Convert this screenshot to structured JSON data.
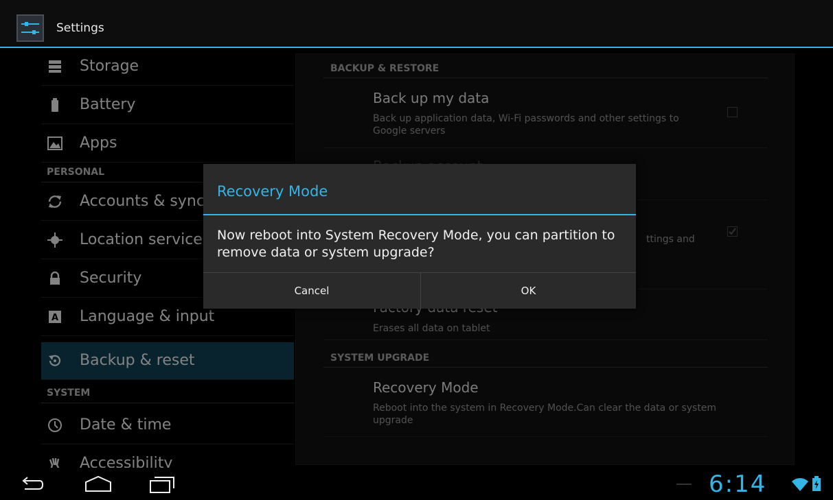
{
  "action_bar": {
    "title": "Settings"
  },
  "sidebar": {
    "items": [
      {
        "label": "Storage",
        "icon": "storage-icon"
      },
      {
        "label": "Battery",
        "icon": "battery-icon"
      },
      {
        "label": "Apps",
        "icon": "apps-icon"
      },
      {
        "label": "Accounts & sync",
        "icon": "sync-icon"
      },
      {
        "label": "Location services",
        "icon": "location-icon"
      },
      {
        "label": "Security",
        "icon": "lock-icon"
      },
      {
        "label": "Language & input",
        "icon": "keyboard-icon"
      },
      {
        "label": "Backup & reset",
        "icon": "backup-icon",
        "selected": true
      },
      {
        "label": "Date & time",
        "icon": "clock-icon"
      },
      {
        "label": "Accessibility",
        "icon": "accessibility-icon"
      }
    ],
    "headers": {
      "personal": "PERSONAL",
      "system": "SYSTEM"
    }
  },
  "panel": {
    "backup_header": "BACKUP & RESTORE",
    "backup_my_data": {
      "title": "Back up my data",
      "summary": "Back up application data, Wi-Fi passwords and other settings to Google servers",
      "checked": false
    },
    "backup_account": {
      "title": "Backup account"
    },
    "auto_restore": {
      "summary_fragment": "ttings and",
      "checked": true
    },
    "factory_reset": {
      "title": "Factory data reset",
      "summary": "Erases all data on tablet"
    },
    "system_upgrade_header": "SYSTEM UPGRADE",
    "recovery_mode": {
      "title": "Recovery Mode",
      "summary": "Reboot into the system in Recovery Mode.Can clear the data or system upgrade"
    }
  },
  "dialog": {
    "title": "Recovery Mode",
    "message": "Now reboot into System Recovery Mode, you can partition to remove data or system upgrade?",
    "cancel_label": "Cancel",
    "ok_label": "OK"
  },
  "status": {
    "time": "6:14"
  },
  "colors": {
    "accent": "#33b5e5",
    "background": "#000000",
    "selected": "#0e3d50",
    "dialog": "#2a2a2a"
  }
}
